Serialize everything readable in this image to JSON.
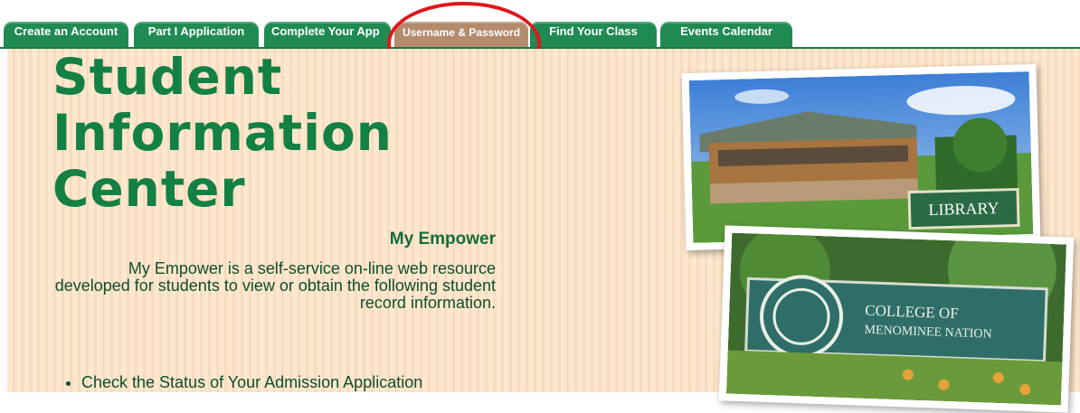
{
  "tabs": [
    {
      "label": "Create an Account",
      "active": false
    },
    {
      "label": "Part I Application",
      "active": false
    },
    {
      "label": "Complete Your App",
      "active": false
    },
    {
      "label": "Username & Password",
      "active": true
    },
    {
      "label": "Find Your Class",
      "active": false
    },
    {
      "label": "Events Calendar",
      "active": false
    }
  ],
  "colors": {
    "tab_green": "#1f8b52",
    "tab_active": "#b48b6d",
    "title_green": "#138044",
    "highlight_red": "#e0161b"
  },
  "header": {
    "title_line1": "Student",
    "title_line2": "Information",
    "title_line3": "Center"
  },
  "section": {
    "heading": "My Empower",
    "description": "My Empower is a self-service on-line web resource developed for students to view or obtain the following student record information.",
    "bullets": [
      "Check the Status of Your Admission Application"
    ]
  },
  "photos": {
    "library_sign": "LIBRARY",
    "college_sign_line1": "COLLEGE OF",
    "college_sign_line2": "MENOMINEE NATION"
  }
}
